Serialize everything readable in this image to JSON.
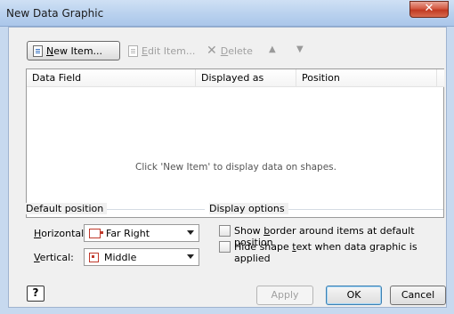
{
  "window": {
    "title": "New Data Graphic",
    "close_glyph": "✕"
  },
  "toolbar": {
    "new_item": {
      "pre": "",
      "key": "N",
      "post": "ew Item..."
    },
    "edit_item": {
      "pre": "",
      "key": "E",
      "post": "dit Item..."
    },
    "delete": {
      "pre": "",
      "key": "D",
      "post": "elete"
    },
    "move_up_glyph": "▲",
    "move_down_glyph": "▼",
    "delete_glyph": "✕"
  },
  "list": {
    "columns": [
      "Data Field",
      "Displayed as",
      "Position"
    ],
    "empty_message": "Click 'New Item' to display data on shapes."
  },
  "default_position": {
    "heading": "Default position",
    "horizontal": {
      "pre": "",
      "key": "H",
      "post": "orizontal:",
      "value": "Far Right"
    },
    "vertical": {
      "pre": "",
      "key": "V",
      "post": "ertical:",
      "value": "Middle"
    }
  },
  "display_options": {
    "heading": "Display options",
    "show_border": {
      "pre": "Show ",
      "key": "b",
      "post": "order around items at default position",
      "checked": false
    },
    "hide_text": {
      "pre": "Hide shape ",
      "key": "t",
      "post": "ext when data graphic is applied",
      "checked": false
    }
  },
  "buttons": {
    "help": "?",
    "apply": "Apply",
    "ok": "OK",
    "cancel": "Cancel"
  },
  "icons": {
    "new": "document-icon",
    "edit": "document-icon",
    "horizontal": "far-right-position-icon",
    "vertical": "middle-position-icon"
  }
}
